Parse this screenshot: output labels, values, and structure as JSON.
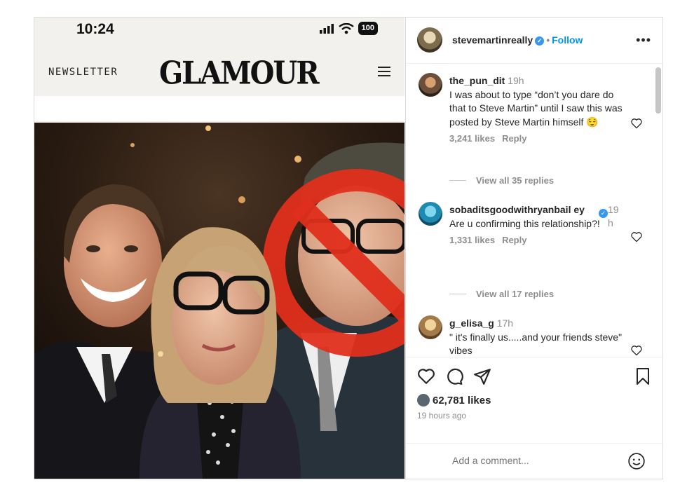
{
  "phone": {
    "time": "10:24",
    "battery": "100",
    "newsletter": "NEWSLETTER",
    "logo": "GLAMOUR"
  },
  "post": {
    "username": "stevemartinreally",
    "follow_label": "Follow",
    "dot": "•",
    "more": "•••",
    "likes": "62,781 likes",
    "posted": "19 hours ago",
    "comment_placeholder": "Add a comment..."
  },
  "comments": [
    {
      "user": "the_pun_dit",
      "time": "19h",
      "text": "I was about to type “don’t you dare do that to Steve Martin” until I saw this was posted by Steve Martin himself 😌",
      "likes": "3,241 likes",
      "reply": "Reply",
      "view_replies": "View all 35 replies"
    },
    {
      "user": "sobaditsgoodwithryanbail ey",
      "time": "19 h",
      "text": "Are u confirming this relationship?!",
      "likes": "1,331 likes",
      "reply": "Reply",
      "view_replies": "View all 17 replies"
    },
    {
      "user": "g_elisa_g",
      "time": "17h",
      "text": "\" it's finally us.....and your friends steve\" vibes"
    }
  ],
  "colors": {
    "link_blue": "#0095f6",
    "verified_blue": "#3897f0",
    "prohibit_red": "#e02f1c"
  }
}
